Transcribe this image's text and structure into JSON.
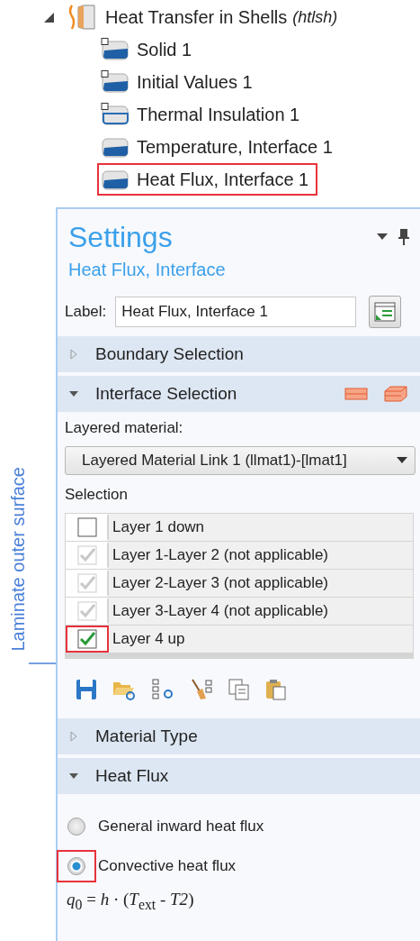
{
  "tree": {
    "root": {
      "label": "Heat Transfer in Shells",
      "tag": "(htlsh)",
      "expanded": true
    },
    "children": [
      {
        "label": "Solid 1",
        "kind": "domain",
        "highlighted": false
      },
      {
        "label": "Initial Values 1",
        "kind": "domain",
        "highlighted": false
      },
      {
        "label": "Thermal Insulation 1",
        "kind": "boundary",
        "highlighted": false
      },
      {
        "label": "Temperature, Interface 1",
        "kind": "pair",
        "highlighted": false
      },
      {
        "label": "Heat Flux, Interface 1",
        "kind": "pair",
        "highlighted": true
      }
    ]
  },
  "annotation": {
    "text": "Laminate outer surface"
  },
  "settings": {
    "title": "Settings",
    "subtitle": "Heat Flux, Interface",
    "label_caption": "Label:",
    "label_value": "Heat Flux, Interface 1",
    "sections": [
      {
        "title": "Boundary Selection",
        "expanded": false
      },
      {
        "title": "Interface Selection",
        "expanded": true,
        "layered_material_caption": "Layered material:",
        "layered_material": "Layered Material Link 1 (llmat1)-[lmat1]",
        "selection_caption": "Selection",
        "rows": [
          {
            "label": "Layer 1 down",
            "checked": false,
            "disabled": false,
            "highlighted": false
          },
          {
            "label": "Layer 1-Layer 2 (not applicable)",
            "checked": true,
            "disabled": true,
            "highlighted": false
          },
          {
            "label": "Layer 2-Layer 3 (not applicable)",
            "checked": true,
            "disabled": true,
            "highlighted": false
          },
          {
            "label": "Layer 3-Layer 4 (not applicable)",
            "checked": true,
            "disabled": true,
            "highlighted": false
          },
          {
            "label": "Layer 4 up",
            "checked": true,
            "disabled": false,
            "highlighted": true
          }
        ]
      },
      {
        "title": "Material Type",
        "expanded": false
      },
      {
        "title": "Heat Flux",
        "expanded": true,
        "options": [
          {
            "label": "General inward heat flux",
            "selected": false,
            "highlighted": false
          },
          {
            "label": "Convective heat flux",
            "selected": true,
            "highlighted": true
          }
        ],
        "formula": "*q*$_{0}$ = *h* · (*T*$_{ext}$ - *T2*)"
      }
    ]
  }
}
